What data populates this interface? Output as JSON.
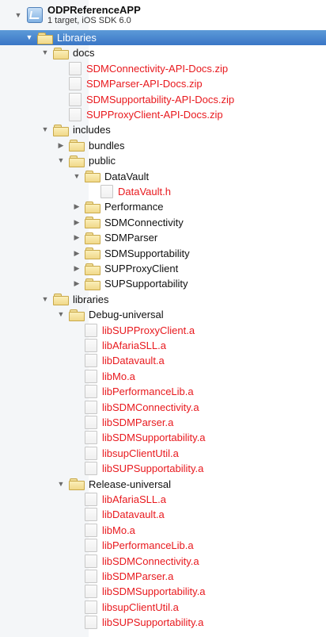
{
  "project": {
    "name": "ODPReferenceAPP",
    "subtitle": "1 target, iOS SDK 6.0"
  },
  "tree": [
    {
      "type": "folder",
      "depth": 0,
      "expanded": true,
      "label": "Libraries",
      "selected": true
    },
    {
      "type": "folder",
      "depth": 1,
      "expanded": true,
      "label": "docs"
    },
    {
      "type": "file",
      "depth": 2,
      "label": "SDMConnectivity-API-Docs.zip"
    },
    {
      "type": "file",
      "depth": 2,
      "label": "SDMParser-API-Docs.zip"
    },
    {
      "type": "file",
      "depth": 2,
      "label": "SDMSupportability-API-Docs.zip"
    },
    {
      "type": "file",
      "depth": 2,
      "label": "SUPProxyClient-API-Docs.zip"
    },
    {
      "type": "folder",
      "depth": 1,
      "expanded": true,
      "label": "includes"
    },
    {
      "type": "folder",
      "depth": 2,
      "expanded": false,
      "label": "bundles"
    },
    {
      "type": "folder",
      "depth": 2,
      "expanded": true,
      "label": "public"
    },
    {
      "type": "folder",
      "depth": 3,
      "expanded": true,
      "label": "DataVault"
    },
    {
      "type": "file",
      "depth": 4,
      "label": "DataVault.h"
    },
    {
      "type": "folder",
      "depth": 3,
      "expanded": false,
      "label": "Performance"
    },
    {
      "type": "folder",
      "depth": 3,
      "expanded": false,
      "label": "SDMConnectivity"
    },
    {
      "type": "folder",
      "depth": 3,
      "expanded": false,
      "label": "SDMParser"
    },
    {
      "type": "folder",
      "depth": 3,
      "expanded": false,
      "label": "SDMSupportability"
    },
    {
      "type": "folder",
      "depth": 3,
      "expanded": false,
      "label": "SUPProxyClient"
    },
    {
      "type": "folder",
      "depth": 3,
      "expanded": false,
      "label": "SUPSupportability"
    },
    {
      "type": "folder",
      "depth": 1,
      "expanded": true,
      "label": "libraries"
    },
    {
      "type": "folder",
      "depth": 2,
      "expanded": true,
      "label": "Debug-universal"
    },
    {
      "type": "file",
      "depth": 3,
      "label": "libSUPProxyClient.a"
    },
    {
      "type": "file",
      "depth": 3,
      "label": "libAfariaSLL.a"
    },
    {
      "type": "file",
      "depth": 3,
      "label": "libDatavault.a"
    },
    {
      "type": "file",
      "depth": 3,
      "label": "libMo.a"
    },
    {
      "type": "file",
      "depth": 3,
      "label": "libPerformanceLib.a"
    },
    {
      "type": "file",
      "depth": 3,
      "label": "libSDMConnectivity.a"
    },
    {
      "type": "file",
      "depth": 3,
      "label": "libSDMParser.a"
    },
    {
      "type": "file",
      "depth": 3,
      "label": "libSDMSupportability.a"
    },
    {
      "type": "file",
      "depth": 3,
      "label": "libsupClientUtil.a"
    },
    {
      "type": "file",
      "depth": 3,
      "label": "libSUPSupportability.a"
    },
    {
      "type": "folder",
      "depth": 2,
      "expanded": true,
      "label": "Release-universal"
    },
    {
      "type": "file",
      "depth": 3,
      "label": "libAfariaSLL.a"
    },
    {
      "type": "file",
      "depth": 3,
      "label": "libDatavault.a"
    },
    {
      "type": "file",
      "depth": 3,
      "label": "libMo.a"
    },
    {
      "type": "file",
      "depth": 3,
      "label": "libPerformanceLib.a"
    },
    {
      "type": "file",
      "depth": 3,
      "label": "libSDMConnectivity.a"
    },
    {
      "type": "file",
      "depth": 3,
      "label": "libSDMParser.a"
    },
    {
      "type": "file",
      "depth": 3,
      "label": "libSDMSupportability.a"
    },
    {
      "type": "file",
      "depth": 3,
      "label": "libsupClientUtil.a"
    },
    {
      "type": "file",
      "depth": 3,
      "label": "libSUPSupportability.a"
    }
  ],
  "colors": {
    "missing_file_text": "#e8191e",
    "selection": "#3a76c6",
    "folder": "#f1d98a"
  }
}
